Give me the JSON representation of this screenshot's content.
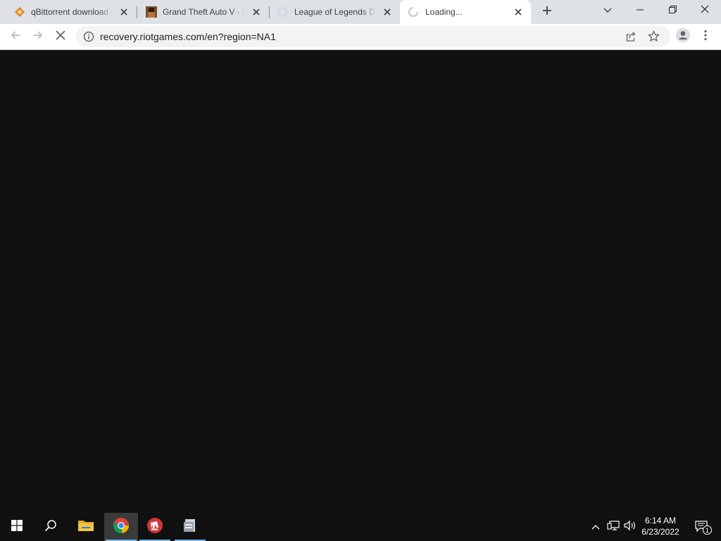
{
  "browser": {
    "tabs": [
      {
        "title": "qBittorrent download |",
        "favicon": "qbittorrent-diamond-icon",
        "active": false
      },
      {
        "title": "Grand Theft Auto V - Fr",
        "favicon": "gta-thumbnail-icon",
        "active": false
      },
      {
        "title": "League of Legends Do",
        "favicon": "loading-circle-icon",
        "active": false
      },
      {
        "title": "Loading...",
        "favicon": "loading-spinner-icon",
        "active": true
      }
    ],
    "new_tab_icon": "plus-icon",
    "window_controls": [
      "chevron-down-icon",
      "minimize-icon",
      "restore-icon",
      "close-icon"
    ],
    "url": "recovery.riotgames.com/en?region=NA1",
    "toolbar_icons": [
      "back-arrow-icon",
      "forward-arrow-icon",
      "stop-loading-icon",
      "info-icon",
      "share-icon",
      "star-icon",
      "profile-icon",
      "kebab-menu-icon"
    ]
  },
  "page": {
    "background": "#111111"
  },
  "taskbar": {
    "apps": [
      "windows-start-icon",
      "search-icon",
      "file-explorer-icon",
      "chrome-icon",
      "riot-client-icon",
      "app-window-icon"
    ],
    "time": "6:14 AM",
    "date": "6/23/2022",
    "notification_count": "1"
  },
  "colors": {
    "tabstrip": "#dee1e6",
    "active_tab": "#ffffff",
    "omnibox": "#f1f3f4",
    "taskbar": "#101010",
    "riot_red": "#d13639",
    "qbit_orange": "#e8841f"
  }
}
